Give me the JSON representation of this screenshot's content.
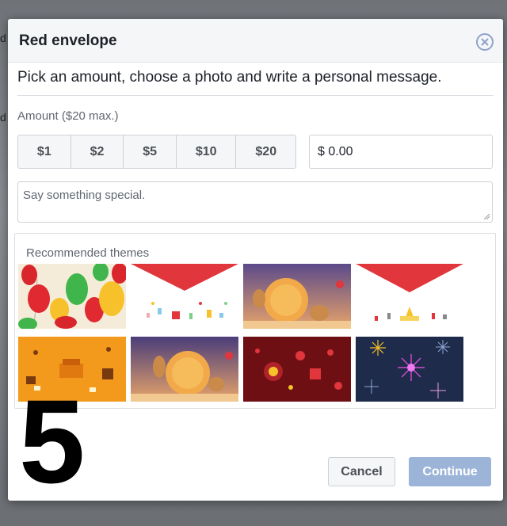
{
  "dialog": {
    "title": "Red envelope",
    "close_icon": "close-circle-icon",
    "intro": "Pick an amount, choose a photo and write a personal message."
  },
  "amount": {
    "label": "Amount ($20 max.)",
    "options": [
      "$1",
      "$2",
      "$5",
      "$10",
      "$20"
    ],
    "input_value": "$ 0.00"
  },
  "message": {
    "placeholder": "Say something special."
  },
  "themes": {
    "label": "Recommended themes",
    "items": [
      "balloons-theme",
      "red-envelope-theme-1",
      "mooncake-theme-1",
      "red-envelope-theme-2",
      "orange-party-theme",
      "mooncake-theme-2",
      "dark-red-festival-theme",
      "fireworks-theme"
    ]
  },
  "overlay_number": "5",
  "buttons": {
    "cancel": "Cancel",
    "continue": "Continue"
  },
  "background_letters": [
    "d",
    "d"
  ],
  "colors": {
    "primary_disabled": "#9cb4d8",
    "header_bg": "#f5f6f7",
    "close_icon": "#8fa2cc"
  }
}
